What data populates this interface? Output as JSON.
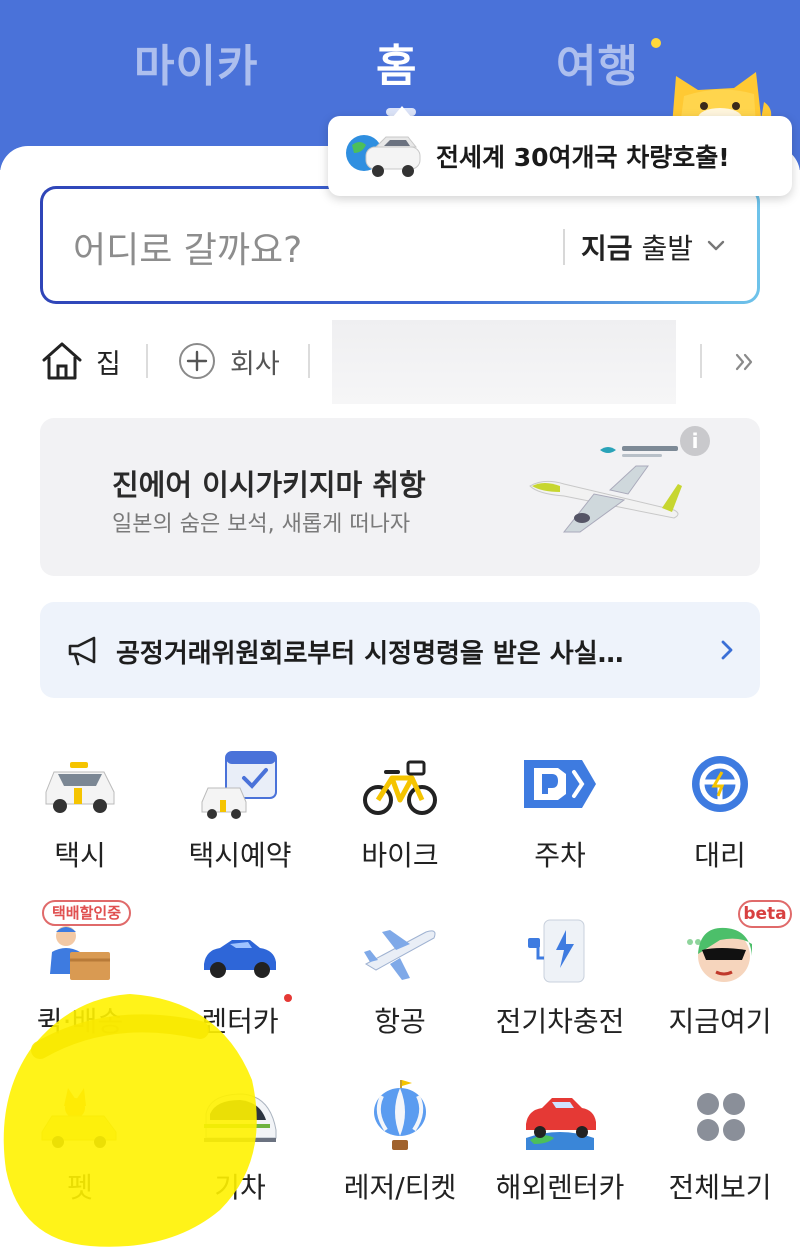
{
  "tabs": [
    {
      "label": "마이카",
      "active": false
    },
    {
      "label": "홈",
      "active": true
    },
    {
      "label": "여행",
      "active": false,
      "has_dot": true
    }
  ],
  "tooltip": {
    "text": "전세계 30여개국 차량호출!"
  },
  "search": {
    "placeholder": "어디로 갈까요?",
    "depart_bold": "지금",
    "depart_rest": "출발"
  },
  "places": {
    "home": "집",
    "company": "회사"
  },
  "banner": {
    "title": "진에어 이시가키지마 취항",
    "subtitle": "일본의 숨은 보석, 새롭게 떠나자",
    "info_symbol": "i"
  },
  "notice": {
    "text": "공정거래위원회로부터 시정명령을 받은 사실…"
  },
  "services": [
    {
      "label": "택시",
      "icon": "taxi-icon"
    },
    {
      "label": "택시예약",
      "icon": "taxi-reservation-icon"
    },
    {
      "label": "바이크",
      "icon": "bike-icon"
    },
    {
      "label": "주차",
      "icon": "parking-icon"
    },
    {
      "label": "대리",
      "icon": "designated-driver-icon"
    },
    {
      "label": "퀵·배송",
      "icon": "delivery-icon",
      "badge": "택배할인중"
    },
    {
      "label": "렌터카",
      "icon": "rental-car-icon",
      "dot": true
    },
    {
      "label": "항공",
      "icon": "airplane-icon"
    },
    {
      "label": "전기차충전",
      "icon": "ev-charging-icon"
    },
    {
      "label": "지금여기",
      "icon": "now-here-icon",
      "badge": "beta"
    },
    {
      "label": "펫",
      "icon": "pet-taxi-icon"
    },
    {
      "label": "기차",
      "icon": "train-icon"
    },
    {
      "label": "레저/티켓",
      "icon": "balloon-icon"
    },
    {
      "label": "해외렌터카",
      "icon": "overseas-rental-icon"
    },
    {
      "label": "전체보기",
      "icon": "view-all-icon"
    }
  ],
  "colors": {
    "brand_blue": "#4a72d9",
    "highlight_yellow": "#fff200",
    "badge_red": "#e05050"
  }
}
